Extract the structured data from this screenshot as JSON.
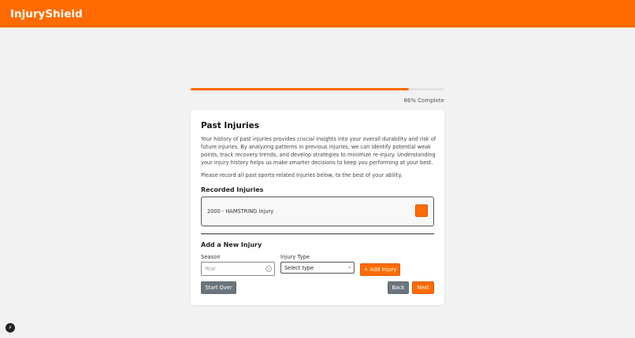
{
  "header": {
    "brand": "InjuryShield"
  },
  "progress": {
    "value": 0.86,
    "label": "86% Complete"
  },
  "card": {
    "title": "Past Injuries",
    "description": "Your history of past injuries provides crucial insights into your overall durability and risk of future injuries. By analyzing patterns in previous injuries, we can identify potential weak points, track recovery trends, and develop strategies to minimize re-injury. Understanding your injury history helps us make smarter decisions to keep you performing at your best.",
    "instruction": "Please record all past sports-related injuries below, to the best of your ability.",
    "recorded_heading": "Recorded Injuries",
    "recorded": [
      {
        "label": "2000 - HAMSTRING Injury",
        "remove_icon": "dot-icon"
      }
    ],
    "add_heading": "Add a New Injury",
    "season": {
      "label": "Season",
      "placeholder": "Year"
    },
    "injury_type": {
      "label": "Injury Type",
      "selected": "Select type"
    },
    "add_button": "+ Add Injury",
    "start_over_button": "Start Over",
    "back_button": "Back",
    "next_button": "Next"
  },
  "colors": {
    "accent": "#ff6b00",
    "secondary": "#6c757d"
  }
}
